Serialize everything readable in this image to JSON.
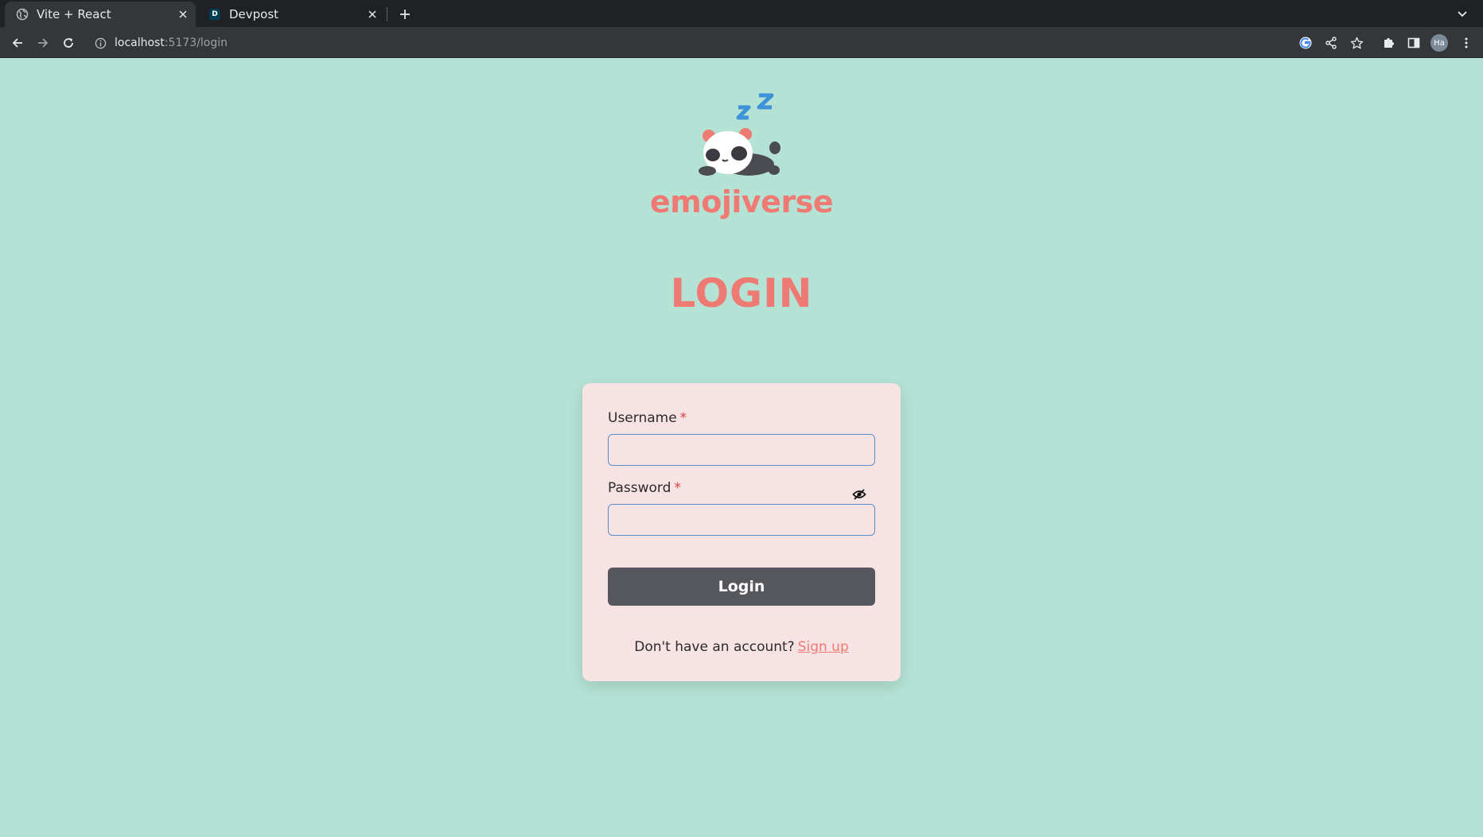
{
  "browser": {
    "tabs": [
      {
        "title": "Vite + React",
        "favicon": "globe-icon",
        "active": true
      },
      {
        "title": "Devpost",
        "favicon": "D",
        "active": false
      }
    ],
    "url_host": "localhost",
    "url_path": ":5173/login",
    "profile_initials": "Ha",
    "icons": [
      "back-icon",
      "forward-icon",
      "reload-icon",
      "info-icon",
      "google-icon",
      "share-icon",
      "star-icon",
      "extensions-icon",
      "sidepanel-icon",
      "menu-icon"
    ]
  },
  "page": {
    "brand": "emojiverse",
    "logo": "sleeping-panda-icon",
    "title": "LOGIN"
  },
  "form": {
    "username_label": "Username",
    "password_label": "Password",
    "required_mark": "*",
    "username_value": "",
    "password_value": "",
    "login_label": "Login",
    "signup_prompt": "Don't have an account?",
    "signup_link": "Sign up"
  },
  "colors": {
    "background": "#b4e2d4",
    "accent": "#ee7a73",
    "card": "#f7e3e4",
    "button": "#55575d",
    "input_border": "#5b8fc9",
    "required": "#e53e3e"
  }
}
